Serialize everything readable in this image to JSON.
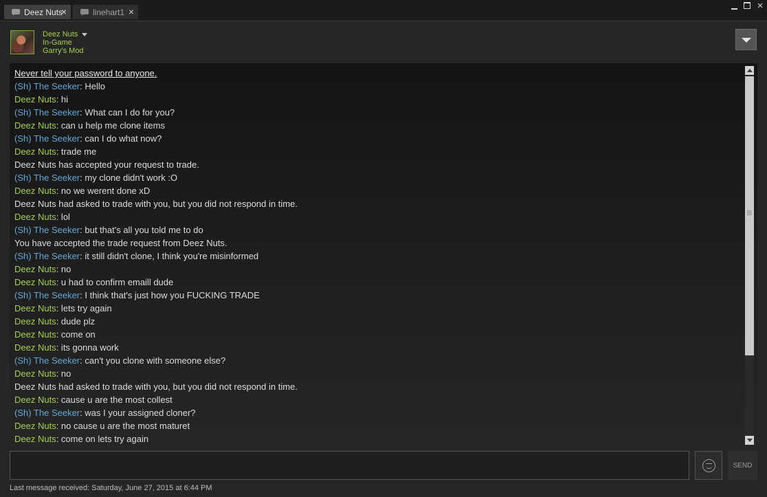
{
  "tabs": [
    {
      "label": "Deez Nuts",
      "close": "×"
    },
    {
      "label": "linehart1",
      "close": "×"
    }
  ],
  "window": {
    "close": "×"
  },
  "header": {
    "name": "Deez Nuts",
    "status": "In-Game",
    "game": "Garry's Mod"
  },
  "chat": {
    "warning": "Never tell your password to anyone.",
    "messages": [
      {
        "type": "me",
        "sender": "(Sh) The Seeker",
        "text": ": Hello"
      },
      {
        "type": "them",
        "sender": "Deez Nuts",
        "text": ": hi"
      },
      {
        "type": "me",
        "sender": "(Sh) The Seeker",
        "text": ": What can I do for you?"
      },
      {
        "type": "them",
        "sender": "Deez Nuts",
        "text": ": can u help me clone items"
      },
      {
        "type": "me",
        "sender": "(Sh) The Seeker",
        "text": ": can I do what now?"
      },
      {
        "type": "them",
        "sender": "Deez Nuts",
        "text": ": trade me"
      },
      {
        "type": "system",
        "sender": "",
        "text": "Deez Nuts has accepted your request to trade."
      },
      {
        "type": "me",
        "sender": "(Sh) The Seeker",
        "text": ": my clone didn't work :O"
      },
      {
        "type": "them",
        "sender": "Deez Nuts",
        "text": ": no we werent done xD"
      },
      {
        "type": "system",
        "sender": "",
        "text": "Deez Nuts had asked to trade with you, but you did not respond in time."
      },
      {
        "type": "them",
        "sender": "Deez Nuts",
        "text": ": lol"
      },
      {
        "type": "me",
        "sender": "(Sh) The Seeker",
        "text": ": but that's all you told me to do"
      },
      {
        "type": "system",
        "sender": "",
        "text": "You have accepted the trade request from Deez Nuts."
      },
      {
        "type": "me",
        "sender": "(Sh) The Seeker",
        "text": ": it still didn't clone, I think you're misinformed"
      },
      {
        "type": "them",
        "sender": "Deez Nuts",
        "text": ": no"
      },
      {
        "type": "them",
        "sender": "Deez Nuts",
        "text": ": u had to confirm emaill dude"
      },
      {
        "type": "me",
        "sender": "(Sh) The Seeker",
        "text": ": I think that's just how you FUCKING TRADE"
      },
      {
        "type": "them",
        "sender": "Deez Nuts",
        "text": ": lets try again"
      },
      {
        "type": "them",
        "sender": "Deez Nuts",
        "text": ": dude plz"
      },
      {
        "type": "them",
        "sender": "Deez Nuts",
        "text": ": come on"
      },
      {
        "type": "them",
        "sender": "Deez Nuts",
        "text": ": its gonna work"
      },
      {
        "type": "me",
        "sender": "(Sh) The Seeker",
        "text": ": can't you clone with someone else?"
      },
      {
        "type": "them",
        "sender": "Deez Nuts",
        "text": ": no"
      },
      {
        "type": "system",
        "sender": "",
        "text": "Deez Nuts had asked to trade with you, but you did not respond in time."
      },
      {
        "type": "them",
        "sender": "Deez Nuts",
        "text": ": cause u are the most collest"
      },
      {
        "type": "me",
        "sender": "(Sh) The Seeker",
        "text": ": was I your assigned cloner?"
      },
      {
        "type": "them",
        "sender": "Deez Nuts",
        "text": ": no cause u are the most maturet"
      },
      {
        "type": "them",
        "sender": "Deez Nuts",
        "text": ": come on lets try again"
      }
    ]
  },
  "input": {
    "value": ""
  },
  "send": {
    "label": "SEND"
  },
  "footer": {
    "status": "Last message received: Saturday, June 27, 2015 at 6:44 PM"
  },
  "colors": {
    "self": "#62a8d4",
    "friend": "#a4d04a",
    "background": "#262626"
  }
}
